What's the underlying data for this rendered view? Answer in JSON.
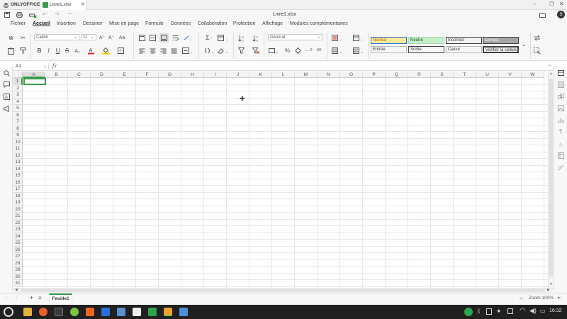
{
  "titlebar": {
    "app_name": "ONLYOFFICE",
    "tab_label": "Livre1.xlsx",
    "document_title": "Livre1.xlsx",
    "avatar_initial": "S"
  },
  "menu": {
    "items": [
      "Fichier",
      "Accueil",
      "Insertion",
      "Dessiner",
      "Mise en page",
      "Formule",
      "Données",
      "Collaboration",
      "Protection",
      "Affichage",
      "Modules complémentaires"
    ],
    "active": "Accueil"
  },
  "ribbon": {
    "font_name": "Calibri",
    "font_size": "11",
    "number_format": "Général",
    "cell_styles": [
      {
        "label": "Normal",
        "bg": "#ffffff",
        "fg": "#333333",
        "border": "#2a6fd6"
      },
      {
        "label": "Neutre",
        "bg": "#ffeb9c",
        "fg": "#9c6500",
        "border": "#e6d28a"
      },
      {
        "label": "Incorrect",
        "bg": "#ffc7ce",
        "fg": "#9c0006",
        "border": "#e6b0b6"
      },
      {
        "label": "Correct",
        "bg": "#c6efce",
        "fg": "#006100",
        "border": "#a8d8b2"
      },
      {
        "label": "Entrée",
        "bg": "#ffcc99",
        "fg": "#3f3f76",
        "border": "#7f7f7f"
      },
      {
        "label": "Sortie",
        "bg": "#f2f2f2",
        "fg": "#3f3f3f",
        "border": "#3f3f3f"
      },
      {
        "label": "Calcul",
        "bg": "#f2f2f2",
        "fg": "#fa7d00",
        "border": "#7f7f7f"
      },
      {
        "label": "Vérifier la cellule",
        "bg": "#a5a5a5",
        "fg": "#ffffff",
        "border": "#3f3f3f"
      }
    ]
  },
  "formula_bar": {
    "name_box": "A1",
    "fx_label": "fx",
    "formula_value": ""
  },
  "grid": {
    "columns": [
      "A",
      "B",
      "C",
      "D",
      "E",
      "F",
      "G",
      "H",
      "I",
      "J",
      "K",
      "L",
      "M",
      "N",
      "O",
      "P",
      "Q",
      "R",
      "S",
      "T",
      "U",
      "V",
      "W"
    ],
    "rows": [
      "1",
      "2",
      "3",
      "4",
      "5",
      "6",
      "7",
      "8",
      "9",
      "10",
      "11",
      "12",
      "13",
      "14",
      "15",
      "16",
      "17",
      "18",
      "19",
      "20",
      "21",
      "22",
      "23",
      "24",
      "25",
      "26",
      "27",
      "28",
      "29",
      "30",
      "31"
    ],
    "selected_cell": "A1"
  },
  "sheets": {
    "tabs": [
      "Feuille1"
    ],
    "active": "Feuille1"
  },
  "status": {
    "zoom_label": "Zoom 100%"
  },
  "taskbar": {
    "clock": "16:32"
  },
  "colors": {
    "accent": "#2a6fd6",
    "tab_underline": "#3a9a4a",
    "taskbar_bg": "#202020"
  }
}
